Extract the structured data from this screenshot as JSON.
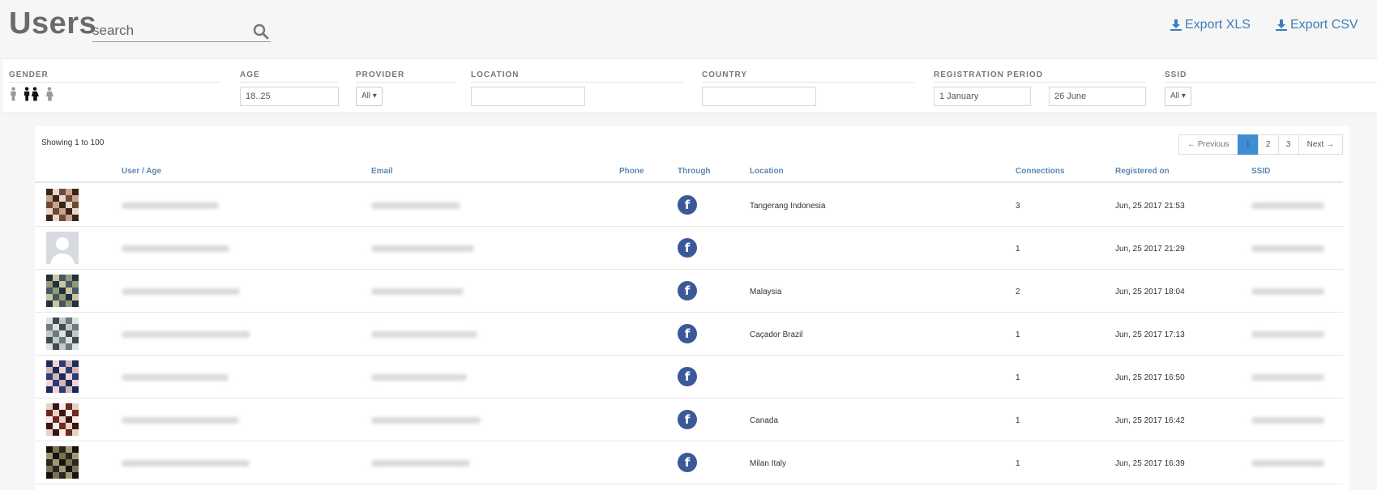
{
  "header": {
    "title": "Users",
    "search_placeholder": "search",
    "export_xls": "Export XLS",
    "export_csv": "Export CSV"
  },
  "filters": {
    "gender": {
      "label": "GENDER",
      "icons": [
        "male-icon",
        "couple-icon",
        "female-icon"
      ]
    },
    "age": {
      "label": "AGE",
      "value": "18..25"
    },
    "provider": {
      "label": "PROVIDER",
      "value": "All"
    },
    "location": {
      "label": "LOCATION",
      "value": ""
    },
    "country": {
      "label": "COUNTRY",
      "value": ""
    },
    "registration_period": {
      "label": "REGISTRATION PERIOD",
      "from": "1 January",
      "to": "26 June"
    },
    "ssid": {
      "label": "SSID",
      "value": "All"
    }
  },
  "table": {
    "showing": "Showing 1 to 100",
    "pagination": {
      "previous": "← Previous",
      "pages": [
        "1",
        "2",
        "3"
      ],
      "active": "1",
      "next": "Next →"
    },
    "columns": [
      "User / Age",
      "Email",
      "Phone",
      "Through",
      "Location",
      "Connections",
      "Registered on",
      "SSID"
    ],
    "rows": [
      {
        "through": "facebook-icon",
        "location": "Tangerang Indonesia",
        "connections": "3",
        "registered": "Jun, 25 2017 21:53"
      },
      {
        "through": "facebook-icon",
        "location": "",
        "connections": "1",
        "registered": "Jun, 25 2017 21:29"
      },
      {
        "through": "facebook-icon",
        "location": "Malaysia",
        "connections": "2",
        "registered": "Jun, 25 2017 18:04"
      },
      {
        "through": "facebook-icon",
        "location": "Caçador Brazil",
        "connections": "1",
        "registered": "Jun, 25 2017 17:13"
      },
      {
        "through": "facebook-icon",
        "location": "",
        "connections": "1",
        "registered": "Jun, 25 2017 16:50"
      },
      {
        "through": "facebook-icon",
        "location": "Canada",
        "connections": "1",
        "registered": "Jun, 25 2017 16:42"
      },
      {
        "through": "facebook-icon",
        "location": "Milan Italy",
        "connections": "1",
        "registered": "Jun, 25 2017 16:39"
      }
    ]
  },
  "colors": {
    "accent": "#3d7eb8",
    "active_page": "#3d8ed3",
    "facebook": "#3b5998",
    "header_text": "#5d87b0"
  }
}
